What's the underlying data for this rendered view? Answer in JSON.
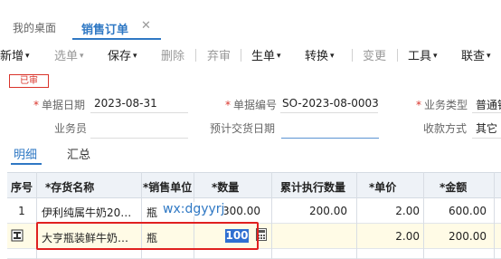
{
  "tabs": {
    "home": "我的桌面",
    "active": "销售订单",
    "close": "✕"
  },
  "toolbar": {
    "new": "新增",
    "select": "选单",
    "save": "保存",
    "delete": "删除",
    "discard": "弃审",
    "generate": "生单",
    "convert": "转换",
    "change": "变更",
    "tools": "工具",
    "linked": "联查",
    "caret": "▾"
  },
  "status_badge": "已审",
  "form": {
    "date_label": "单据日期",
    "date_value": "2023-08-31",
    "number_label": "单据编号",
    "number_value": "SO-2023-08-0003",
    "biztype_label": "业务类型",
    "biztype_value": "普通销",
    "salesman_label": "业务员",
    "delivery_label": "预计交货日期",
    "payment_label": "收款方式",
    "payment_value": "其它",
    "required_mark": "*"
  },
  "subtabs": [
    "明细",
    "汇总"
  ],
  "table": {
    "headers": [
      "序号",
      "*存货名称",
      "*销售单位",
      "*数量",
      "累计执行数量",
      "*单价",
      "*金额"
    ],
    "rows": [
      {
        "seq": "1",
        "name": "伊利纯属牛奶20…",
        "unit": "瓶",
        "qty": "300.00",
        "executed": "200.00",
        "price": "2.00",
        "amount": "600.00"
      },
      {
        "seq": "",
        "name": "大亨瓶装鲜牛奶…",
        "unit": "瓶",
        "qty": "100",
        "executed": "",
        "price": "2.00",
        "amount": "200.00"
      }
    ]
  },
  "watermark": "wx:dgyyrj",
  "colors": {
    "accent": "#2f78c4",
    "badge": "#d9342b",
    "highlight_row": "#fffbe6",
    "selection": "#2f6fd1",
    "annotation_box": "#e02020"
  },
  "icons": {
    "row_edit": "row-edit-icon",
    "calculator": "calculator-icon"
  }
}
